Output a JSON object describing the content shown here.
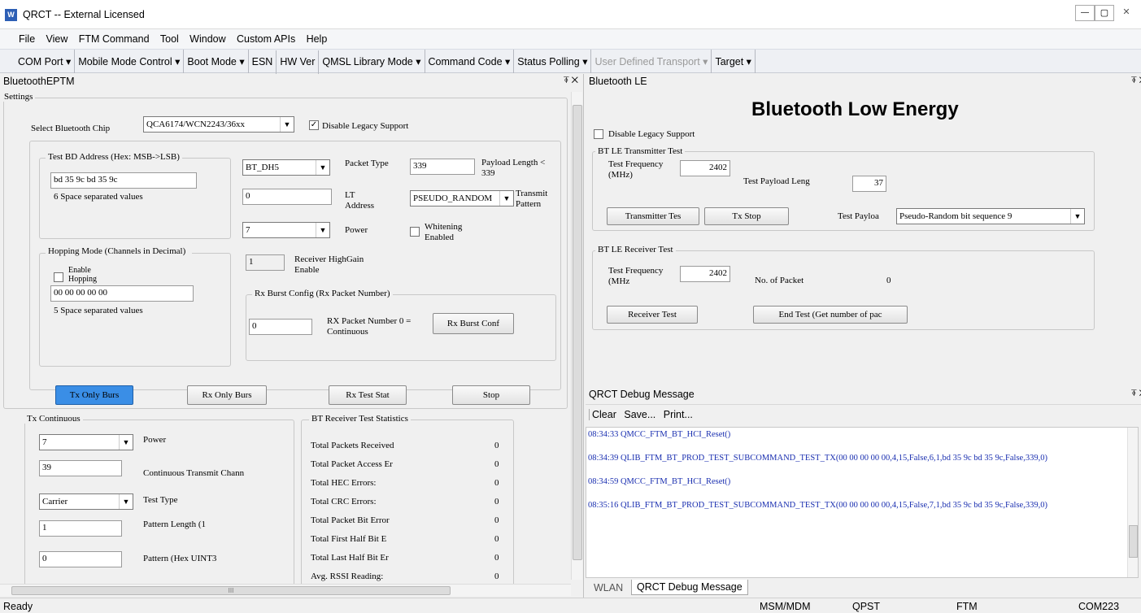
{
  "window": {
    "title": "QRCT -- External Licensed",
    "controls": [
      "—",
      "▢",
      "✕"
    ]
  },
  "menu": [
    "File",
    "View",
    "FTM Command",
    "Tool",
    "Window",
    "Custom APIs",
    "Help"
  ],
  "toolbar": [
    "COM Port ▾",
    "Mobile Mode Control ▾",
    "Boot Mode ▾",
    "ESN",
    "HW Ver",
    "QMSL Library Mode ▾",
    "Command Code ▾",
    "Status Polling ▾",
    "User Defined Transport ▾",
    "Target ▾"
  ],
  "left": {
    "title": "BluetoothEPTM",
    "pin": "⍕ ✕",
    "settings_label": "Settings",
    "chip_label": "Select Bluetooth Chip",
    "chip_value": "QCA6174/WCN2243/36xx",
    "legacy_label": "Disable Legacy Support",
    "bd_group": "Test BD Address (Hex: MSB->LSB)",
    "bd_value": "bd 35 9c bd 35 9c",
    "bd_hint": "6 Space separated values",
    "packet_type_sel": "BT_DH5",
    "packet_type_label": "Packet Type",
    "packet_type_value": "339",
    "payload_label": "Payload Length < 339",
    "lt_value": "0",
    "lt_label": "LT Address",
    "pseudo_sel": "PSEUDO_RANDOM",
    "transmit_label": "Transmit Pattern",
    "power_sel": "7",
    "power_label": "Power",
    "whitening_label": "Whitening Enabled",
    "hop_group": "Hopping Mode (Channels in Decimal)",
    "enable_hop": "Enable Hopping",
    "hop_value": "00 00 00 00 00",
    "hop_hint": "5 Space separated values",
    "highgain_value": "1",
    "highgain_label": "Receiver HighGain Enable",
    "rxburst_group": "Rx Burst Config (Rx Packet Number)",
    "rxpkt_value": "0",
    "rxpkt_label": "RX Packet Number 0 = Continuous",
    "rxburst_btn": "Rx Burst Conf",
    "buttons": [
      "Tx Only Burs",
      "Rx Only Burs",
      "Rx Test Stat",
      "Stop"
    ],
    "txc_group": "Tx Continuous",
    "txc_power_sel": "7",
    "txc_power_label": "Power",
    "txc_chan_value": "39",
    "txc_chan_label": "Continuous Transmit Chann",
    "txc_type_sel": "Carrier",
    "txc_type_label": "Test Type",
    "txc_len_value": "1",
    "txc_len_label": "Pattern Length (1",
    "txc_pat_value": "0",
    "txc_pat_label": "Pattern (Hex UINT3",
    "stats_group": "BT Receiver Test Statistics",
    "stats": [
      {
        "label": "Total Packets Received",
        "value": "0"
      },
      {
        "label": "Total Packet Access Er",
        "value": "0"
      },
      {
        "label": "Total HEC Errors:",
        "value": "0"
      },
      {
        "label": "Total CRC Errors:",
        "value": "0"
      },
      {
        "label": "Total Packet Bit Error",
        "value": "0"
      },
      {
        "label": "Total First Half Bit E",
        "value": "0"
      },
      {
        "label": "Total Last Half Bit Er",
        "value": "0"
      },
      {
        "label": "Avg. RSSI Reading:",
        "value": "0"
      }
    ],
    "hscroll_mark": "III"
  },
  "right": {
    "title": "Bluetooth LE",
    "pin": "⍕ ✕",
    "heading": "Bluetooth Low Energy",
    "legacy_label": "Disable Legacy Support",
    "tx_group": "BT LE Transmitter Test",
    "tx_freq_label": "Test Frequency (MHz)",
    "tx_freq_value": "2402",
    "payload_len_label": "Test Payload Leng",
    "payload_len_value": "37",
    "tx_btn": "Transmitter Tes",
    "txstop_btn": "Tx Stop",
    "payload_type_label": "Test Payloa",
    "payload_type_sel": "Pseudo-Random bit sequence 9",
    "rx_group": "BT LE Receiver Test",
    "rx_freq_label": "Test Frequency (MHz",
    "rx_freq_value": "2402",
    "npkt_label": "No. of Packet",
    "npkt_value": "0",
    "rx_btn": "Receiver Test",
    "end_btn": "End Test (Get number of pac"
  },
  "debug": {
    "title": "QRCT Debug Message",
    "pin": "⍕ ✕",
    "tools": [
      "Clear",
      "Save...",
      "Print..."
    ],
    "lines": [
      "08:34:33  QMCC_FTM_BT_HCI_Reset()",
      "08:34:39  QLIB_FTM_BT_PROD_TEST_SUBCOMMAND_TEST_TX(00 00 00 00 00,4,15,False,6,1,bd 35 9c bd 35 9c,False,339,0)",
      "08:34:59  QMCC_FTM_BT_HCI_Reset()",
      "08:35:16  QLIB_FTM_BT_PROD_TEST_SUBCOMMAND_TEST_TX(00 00 00 00 00,4,15,False,7,1,bd 35 9c bd 35 9c,False,339,0)"
    ],
    "tabs": [
      "WLAN",
      "QRCT Debug Message"
    ]
  },
  "status": {
    "ready": "Ready",
    "cells": [
      "MSM/MDM",
      "QPST",
      "FTM",
      "COM223"
    ]
  }
}
